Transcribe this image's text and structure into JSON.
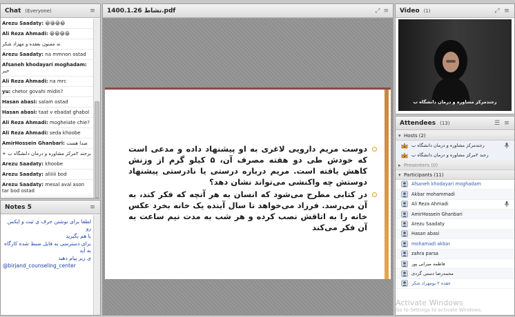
{
  "chat": {
    "title": "Chat",
    "scope": "(Everyone)",
    "messages": [
      {
        "sender": "Arezu Saadaty:",
        "text": "😀😀😀😀"
      },
      {
        "sender": "Ali Reza Ahmadi:",
        "text": "😀😀😀😀"
      },
      {
        "sender": "",
        "text": "نه ممنون بعقده و مهزاد شکر"
      },
      {
        "sender": "Arezu Saadaty:",
        "text": "na mmnon ostad"
      },
      {
        "sender": "Afsaneh khodayari moghadam:",
        "text": "خیر"
      },
      {
        "sender": "Ali Reza Ahmadi:",
        "text": "na mrc"
      },
      {
        "sender": "yu:",
        "text": "chetor govahi midin?"
      },
      {
        "sender": "Hasan abasi:",
        "text": "salam ostad"
      },
      {
        "sender": "Hasan abasi:",
        "text": "taat v ebadat ghabol"
      },
      {
        "sender": "Ali Reza Ahmadi:",
        "text": "mogheiate chie?"
      },
      {
        "sender": "Ali Reza Ahmadi:",
        "text": "seda khoobe"
      },
      {
        "sender": "AmirHossein Ghanbari:",
        "text": "صدا هست"
      },
      {
        "sender": "",
        "text": "+ برجند ۲مرکز مشاوره و درمان دانشگاه ب"
      },
      {
        "sender": "Arezu Saadaty:",
        "text": "khoobe"
      },
      {
        "sender": "Arezu Saadaty:",
        "text": "aliiiii bod"
      },
      {
        "sender": "Arezu Saadaty:",
        "text": "mesal aval ason tar bod ostad"
      }
    ]
  },
  "notes": {
    "title": "Notes 5",
    "lines": [
      "لطفا برای نوشتن حرف ی ثبت و ایکس رو",
      "با هم بگیرید",
      "برای دسترسی به فایل ضبط شده کارگاه به آید",
      "ی زیر پیام دهید",
      "@birjand_counseling_center"
    ]
  },
  "share": {
    "title": "1400.1.26 نشاط.pdf",
    "slide_paragraphs": [
      "دوست مریم دارویی لاغری به او پیشنهاد داده و مدعی است که خودش طی دو هفته مصرف آن، ۵ کیلو گرم از وزنش کاهش یافته است. مریم درباره درستی یا نادرستی پیشنهاد دوستش چه واکنشی می‌تواند نشان دهد؟",
      "در کتابی مطرح می‌شود که انسان به هر آنچه که فکر کند، به آن می‌رسد. فرزاد می‌خواهد تا سال آینده یک خانه بخرد عکس خانه را به اتاقش نصب کرده و هر شب به مدت نیم ساعت به آن فکر می‌کند"
    ]
  },
  "video": {
    "title": "Video",
    "count": "(1)",
    "caption": "رجندمرکز مشاوره و درمان دانشگاه ب"
  },
  "attendees": {
    "title": "Attendees",
    "count": "(13)",
    "hosts_label": "Hosts (2)",
    "hosts": [
      "رجندمرکز مشاوره و درمان دانشگاه ب",
      "رجند ۲مرکز مشاوره و درمان دانشگاه ب"
    ],
    "presenters_label": "Presenters (0)",
    "participants_label": "Participants (11)",
    "participants": [
      "Afsaneh khodayari moghadam",
      "Akbar mohammadi",
      "Ali Reza Ahmadi",
      "AmirHossein Ghanbari",
      "Arezu Saadaty",
      "Hasan abasi",
      "mohamadi akbar",
      "zahra parsa",
      "فاطمه میرانی پور",
      "محمدرضا دستی گردی",
      "عقده ۲ بومهزاد شکر"
    ],
    "watermark_title": "Activate Windows",
    "watermark_sub": "Go to Settings to activate Windows."
  },
  "colors": {
    "slide_top": "#8b4a4a",
    "slide_border": "#e8a54b",
    "bullet": "#d9a02b",
    "notes_text": "#1a3fa8",
    "link_blue": "#2b5ea8"
  }
}
